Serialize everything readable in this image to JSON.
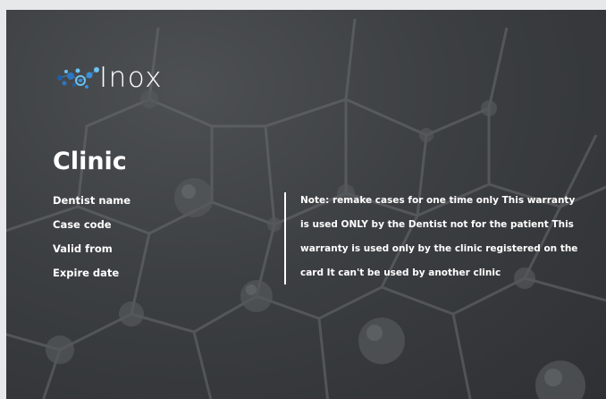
{
  "brand": {
    "logo_icon": "molecule-dots-logo-icon",
    "name": "Inox",
    "colors": {
      "dark_blue": "#1f5fa8",
      "mid_blue": "#3a8fd8",
      "light_blue": "#6cc1f0",
      "text": "#ffffff"
    }
  },
  "card": {
    "title": "Clinic",
    "fields": [
      {
        "label": "Dentist name"
      },
      {
        "label": "Case code"
      },
      {
        "label": "Valid from"
      },
      {
        "label": "Expire date"
      }
    ],
    "note": "Note: remake cases for one time only This warranty is used ONLY by the Dentist not for the patient This warranty is used only by the clinic registered on the card It can't be used by another clinic",
    "background_color": "#3a3d40"
  }
}
